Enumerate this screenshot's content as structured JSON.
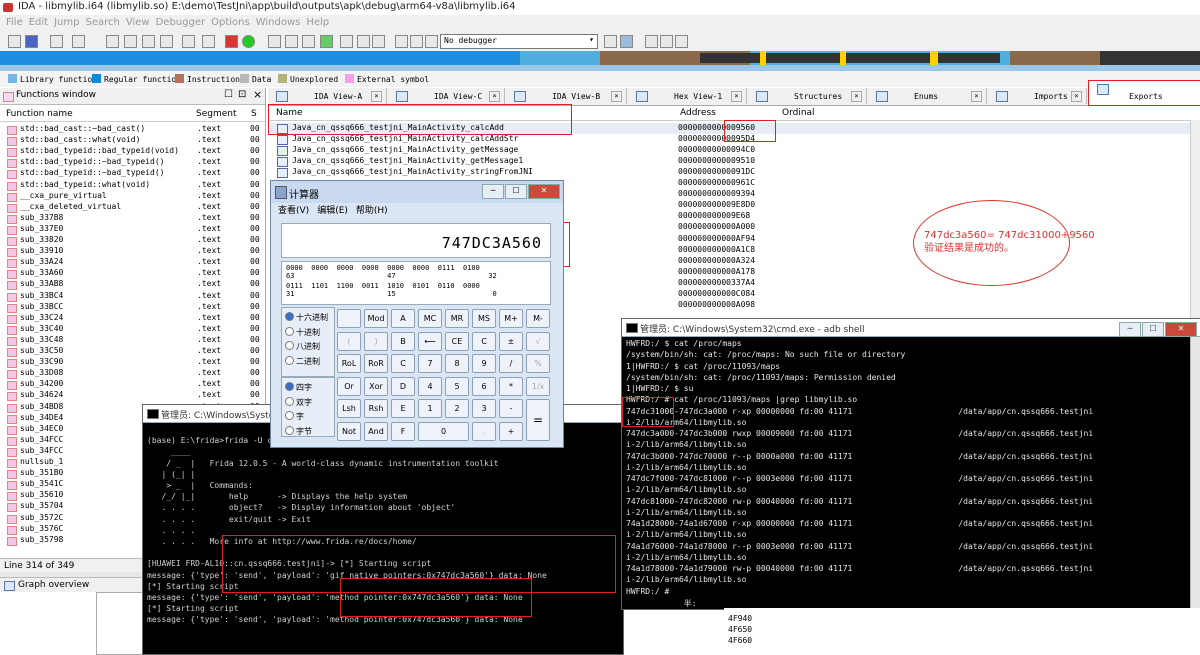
{
  "window": {
    "title": "IDA - libmylib.i64 (libmylib.so) E:\\demo\\TestJni\\app\\build\\outputs\\apk\\debug\\arm64-v8a\\libmylib.i64"
  },
  "menu": [
    "File",
    "Edit",
    "Jump",
    "Search",
    "View",
    "Debugger",
    "Options",
    "Windows",
    "Help"
  ],
  "toolbar": {
    "debugger": "No debugger"
  },
  "legend": [
    {
      "label": "Library function",
      "color": "#77b6e4"
    },
    {
      "label": "Regular function",
      "color": "#0b8ad8"
    },
    {
      "label": "Instruction",
      "color": "#b5735e"
    },
    {
      "label": "Data",
      "color": "#b8b8b8"
    },
    {
      "label": "Unexplored",
      "color": "#b2b27a"
    },
    {
      "label": "External symbol",
      "color": "#f2a0e8"
    }
  ],
  "functions": {
    "title": "Functions window",
    "col_name": "Function name",
    "col_segment": "Segment",
    "col_extra": "S",
    "rows": [
      {
        "name": "std::bad_cast::~bad_cast()",
        "seg": ".text"
      },
      {
        "name": "std::bad_cast::what(void)",
        "seg": ".text"
      },
      {
        "name": "std::bad_typeid::bad_typeid(void)",
        "seg": ".text"
      },
      {
        "name": "std::bad_typeid::~bad_typeid()",
        "seg": ".text"
      },
      {
        "name": "std::bad_typeid::~bad_typeid()",
        "seg": ".text"
      },
      {
        "name": "std::bad_typeid::what(void)",
        "seg": ".text"
      },
      {
        "name": "__cxa_pure_virtual",
        "seg": ".text"
      },
      {
        "name": "__cxa_deleted_virtual",
        "seg": ".text"
      },
      {
        "name": "sub_337B8",
        "seg": ".text"
      },
      {
        "name": "sub_337E0",
        "seg": ".text"
      },
      {
        "name": "sub_33820",
        "seg": ".text"
      },
      {
        "name": "sub_33910",
        "seg": ".text"
      },
      {
        "name": "sub_33A24",
        "seg": ".text"
      },
      {
        "name": "sub_33A60",
        "seg": ".text"
      },
      {
        "name": "sub_33AB8",
        "seg": ".text"
      },
      {
        "name": "sub_33BC4",
        "seg": ".text"
      },
      {
        "name": "sub_33BCC",
        "seg": ".text"
      },
      {
        "name": "sub_33C24",
        "seg": ".text"
      },
      {
        "name": "sub_33C40",
        "seg": ".text"
      },
      {
        "name": "sub_33C48",
        "seg": ".text"
      },
      {
        "name": "sub_33C50",
        "seg": ".text"
      },
      {
        "name": "sub_33C90",
        "seg": ".text"
      },
      {
        "name": "sub_33D08",
        "seg": ".text"
      },
      {
        "name": "sub_34200",
        "seg": ".text"
      },
      {
        "name": "sub_34624",
        "seg": ".text"
      },
      {
        "name": "sub_34BD8",
        "seg": ".text"
      },
      {
        "name": "sub_34DE4",
        "seg": ".text"
      },
      {
        "name": "sub_34EC0",
        "seg": ".text"
      },
      {
        "name": "sub_34FCC",
        "seg": ".text"
      },
      {
        "name": "sub_34FCC",
        "seg": ".text"
      },
      {
        "name": "nullsub_1",
        "seg": ".text"
      },
      {
        "name": "sub_351B0",
        "seg": ".text"
      },
      {
        "name": "sub_3541C",
        "seg": ".text"
      },
      {
        "name": "sub_35610",
        "seg": ".text"
      },
      {
        "name": "sub_35704",
        "seg": ".text"
      },
      {
        "name": "sub_3572C",
        "seg": ".text"
      },
      {
        "name": "sub_3576C",
        "seg": ".text"
      },
      {
        "name": "sub_35798",
        "seg": ".text"
      }
    ],
    "status": "Line 314 of 349",
    "graph_overview": "Graph overview"
  },
  "tabs": [
    "IDA View-A",
    "IDA View-C",
    "IDA View-B",
    "Hex View-1",
    "Structures",
    "Enums",
    "Imports",
    "Exports"
  ],
  "exports": {
    "col_name": "Name",
    "col_address": "Address",
    "col_ordinal": "Ordinal",
    "rows": [
      {
        "name": "Java_cn_qssq666_testjni_MainActivity_calcAdd",
        "addr": "0000000000009560"
      },
      {
        "name": "Java_cn_qssq666_testjni_MainActivity_calcAddStr",
        "addr": "00000000000095D4"
      },
      {
        "name": "Java_cn_qssq666_testjni_MainActivity_getMessage",
        "addr": "00000000000094C0"
      },
      {
        "name": "Java_cn_qssq666_testjni_MainActivity_getMessage1",
        "addr": "0000000000009510"
      },
      {
        "name": "Java_cn_qssq666_testjni_MainActivity_stringFromJNI",
        "addr": "00000000000091DC"
      },
      {
        "name": "",
        "addr": "000000000000961C"
      },
      {
        "name": "",
        "addr": "0000000000009394"
      },
      {
        "name": "",
        "addr": "000000000009E8D0"
      },
      {
        "name": "",
        "addr": "000000000009E68"
      },
      {
        "name": "",
        "addr": "000000000000A000"
      },
      {
        "name": "",
        "addr": "000000000000AF94"
      },
      {
        "name": "",
        "addr": "000000000000A1C8"
      },
      {
        "name": "",
        "addr": "000000000000A324"
      },
      {
        "name": "",
        "addr": "000000000000A178"
      },
      {
        "name": "",
        "addr": "00000000000337A4"
      },
      {
        "name": "",
        "addr": "000000000000C084"
      },
      {
        "name": "",
        "addr": "000000000000A098"
      }
    ],
    "lower_addrs": [
      "4F940",
      "4F650",
      "4F660"
    ]
  },
  "annotation": {
    "line1": "747dc3a560= 747dc31000+9560",
    "line2": "验证结果是成功的。"
  },
  "calculator": {
    "title": "计算器",
    "menu": [
      "查看(V)",
      "编辑(E)",
      "帮助(H)"
    ],
    "display": "747DC3A560",
    "bits_row1": "0000  0000  0000  0000  0000  0000  0111  0100",
    "bits_row1_idx": "63                      47                      32",
    "bits_row2": "0111  1101  1100  0011  1010  0101  0110  0000",
    "bits_row2_idx": "31                      15                       0",
    "bases": [
      "十六进制",
      "十进制",
      "八进制",
      "二进制"
    ],
    "words": [
      "四字",
      "双字",
      "字",
      "字节"
    ],
    "buttons": [
      [
        "",
        "Mod",
        "A",
        "MC",
        "MR",
        "MS",
        "M+",
        "M-"
      ],
      [
        "(",
        ")",
        "B",
        "⟵",
        "CE",
        "C",
        "±",
        "√"
      ],
      [
        "RoL",
        "RoR",
        "C",
        "7",
        "8",
        "9",
        "/",
        "%"
      ],
      [
        "Or",
        "Xor",
        "D",
        "4",
        "5",
        "6",
        "*",
        "1/x"
      ],
      [
        "Lsh",
        "Rsh",
        "E",
        "1",
        "2",
        "3",
        "-",
        "="
      ],
      [
        "Not",
        "And",
        "F",
        "0",
        "",
        ".",
        "+",
        ""
      ]
    ]
  },
  "cmd_left": {
    "title": "管理员: C:\\Windows\\System32\\cmd.exe - frida -U cn.qssq666.testjni -l hook.js",
    "lines": [
      "",
      "(base) E:\\frida>frida -U cn.qssq666.testjni -l hook.js",
      "     ____",
      "    / _  |   Frida 12.0.5 - A world-class dynamic instrumentation toolkit",
      "   | (_| |",
      "    > _  |   Commands:",
      "   /_/ |_|       help      -> Displays the help system",
      "   . . . .       object?   -> Display information about 'object'",
      "   . . . .       exit/quit -> Exit",
      "   . . . .",
      "   . . . .   More info at http://www.frida.re/docs/home/",
      "",
      "[HUAWEI FRD-AL10::cn.qssq666.testjni]-> [*] Starting script",
      "message: {'type': 'send', 'payload': 'gif native pointers:0x747dc3a560'} data: None",
      "[*] Starting script",
      "message: {'type': 'send', 'payload': 'method pointer:0x747dc3a560'} data: None",
      "[*] Starting script",
      "message: {'type': 'send', 'payload': 'method pointer:0x747dc3a560'} data: None"
    ]
  },
  "cmd_right": {
    "title": "管理员: C:\\Windows\\System32\\cmd.exe - adb  shell",
    "lines": [
      "HWFRD:/ $ cat /proc/maps",
      "/system/bin/sh: cat: /proc/maps: No such file or directory",
      "1|HWFRD:/ $ cat /proc/11093/maps",
      "/system/bin/sh: cat: /proc/11093/maps: Permission denied",
      "1|HWFRD:/ $ su",
      "HWFRD:/ # cat /proc/11093/maps |grep libmylib.so",
      "747dc31000-747dc3a000 r-xp 00000000 fd:00 41171                      /data/app/cn.qssq666.testjni",
      "i-2/lib/arm64/libmylib.so",
      "747dc3a000-747dc3b000 rwxp 00009000 fd:00 41171                      /data/app/cn.qssq666.testjni",
      "i-2/lib/arm64/libmylib.so",
      "747dc3b000-747dc70000 r--p 0000a000 fd:00 41171                      /data/app/cn.qssq666.testjni",
      "i-2/lib/arm64/libmylib.so",
      "747dc7f000-747dc81000 r--p 0003e000 fd:00 41171                      /data/app/cn.qssq666.testjni",
      "i-2/lib/arm64/libmylib.so",
      "747dc81000-747dc82000 rw-p 00040000 fd:00 41171                      /data/app/cn.qssq666.testjni",
      "i-2/lib/arm64/libmylib.so",
      "74a1d28000-74a1d67000 r-xp 00000000 fd:00 41171                      /data/app/cn.qssq666.testjni",
      "i-2/lib/arm64/libmylib.so",
      "74a1d76000-74a1d78000 r--p 0003e000 fd:00 41171                      /data/app/cn.qssq666.testjni",
      "i-2/lib/arm64/libmylib.so",
      "74a1d78000-74a1d79000 rw-p 00040000 fd:00 41171                      /data/app/cn.qssq666.testjni",
      "i-2/lib/arm64/libmylib.so",
      "HWFRD:/ #",
      "            半:"
    ]
  }
}
